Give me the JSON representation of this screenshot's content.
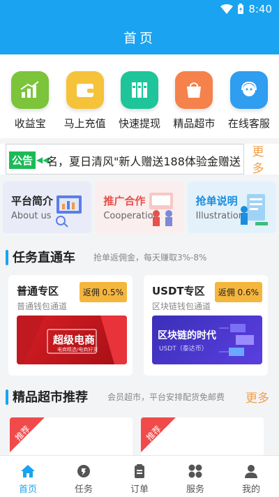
{
  "status_bar": {
    "time": "8:40"
  },
  "header": {
    "title": "首页"
  },
  "quick_menu": [
    {
      "label": "收益宝",
      "icon": "chart-up-icon",
      "color": "#7cc43a"
    },
    {
      "label": "马上充值",
      "icon": "wallet-icon",
      "color": "#f5c23a"
    },
    {
      "label": "快速提现",
      "icon": "binders-icon",
      "color": "#1ec59a"
    },
    {
      "label": "精品超市",
      "icon": "shopping-bag-icon",
      "color": "#f5824b"
    },
    {
      "label": "在线客服",
      "icon": "support-agent-icon",
      "color": "#2f9df0"
    }
  ],
  "notice": {
    "tag": "公告",
    "text": "名，夏日清风\"新人赠送188体验金赠送",
    "more": "更多"
  },
  "promos": [
    {
      "title": "平台简介",
      "subtitle": "About us",
      "bg": "#e9ecf8",
      "title_color": "#222222"
    },
    {
      "title": "推广合作",
      "subtitle": "Cooperation",
      "bg": "#fbeeee",
      "title_color": "#e8504a"
    },
    {
      "title": "抢单说明",
      "subtitle": "Illustration",
      "bg": "#e3f1fb",
      "title_color": "#1a8ee0"
    }
  ],
  "task_section": {
    "title": "任务直通车",
    "subtitle": "抢单返佣金，每天赚取3%-8%"
  },
  "task_cards": [
    {
      "title": "普通专区",
      "subtitle": "普通钱包通道",
      "badge": "返佣 0.5%",
      "banner_title": "超级电商",
      "banner_sub": "电商精选/电商好货"
    },
    {
      "title": "USDT专区",
      "subtitle": "区块链钱包通道",
      "badge": "返佣 0.6%",
      "banner_title": "区块链的时代",
      "banner_sub": "USDT（泰达币）"
    }
  ],
  "shop_section": {
    "title": "精品超市推荐",
    "subtitle": "会员超市，平台安排配货免邮费",
    "more": "更多"
  },
  "shop_cards": [
    {
      "ribbon": "推荐"
    },
    {
      "ribbon": "推荐"
    }
  ],
  "tabs": [
    {
      "label": "首页",
      "icon": "home-icon",
      "active": true
    },
    {
      "label": "任务",
      "icon": "task-icon",
      "active": false
    },
    {
      "label": "订单",
      "icon": "order-icon",
      "active": false
    },
    {
      "label": "服务",
      "icon": "service-icon",
      "active": false
    },
    {
      "label": "我的",
      "icon": "profile-icon",
      "active": false
    }
  ],
  "colors": {
    "primary": "#1aa3f0",
    "accent": "#f0a04b",
    "badge": "#f5b63d"
  }
}
